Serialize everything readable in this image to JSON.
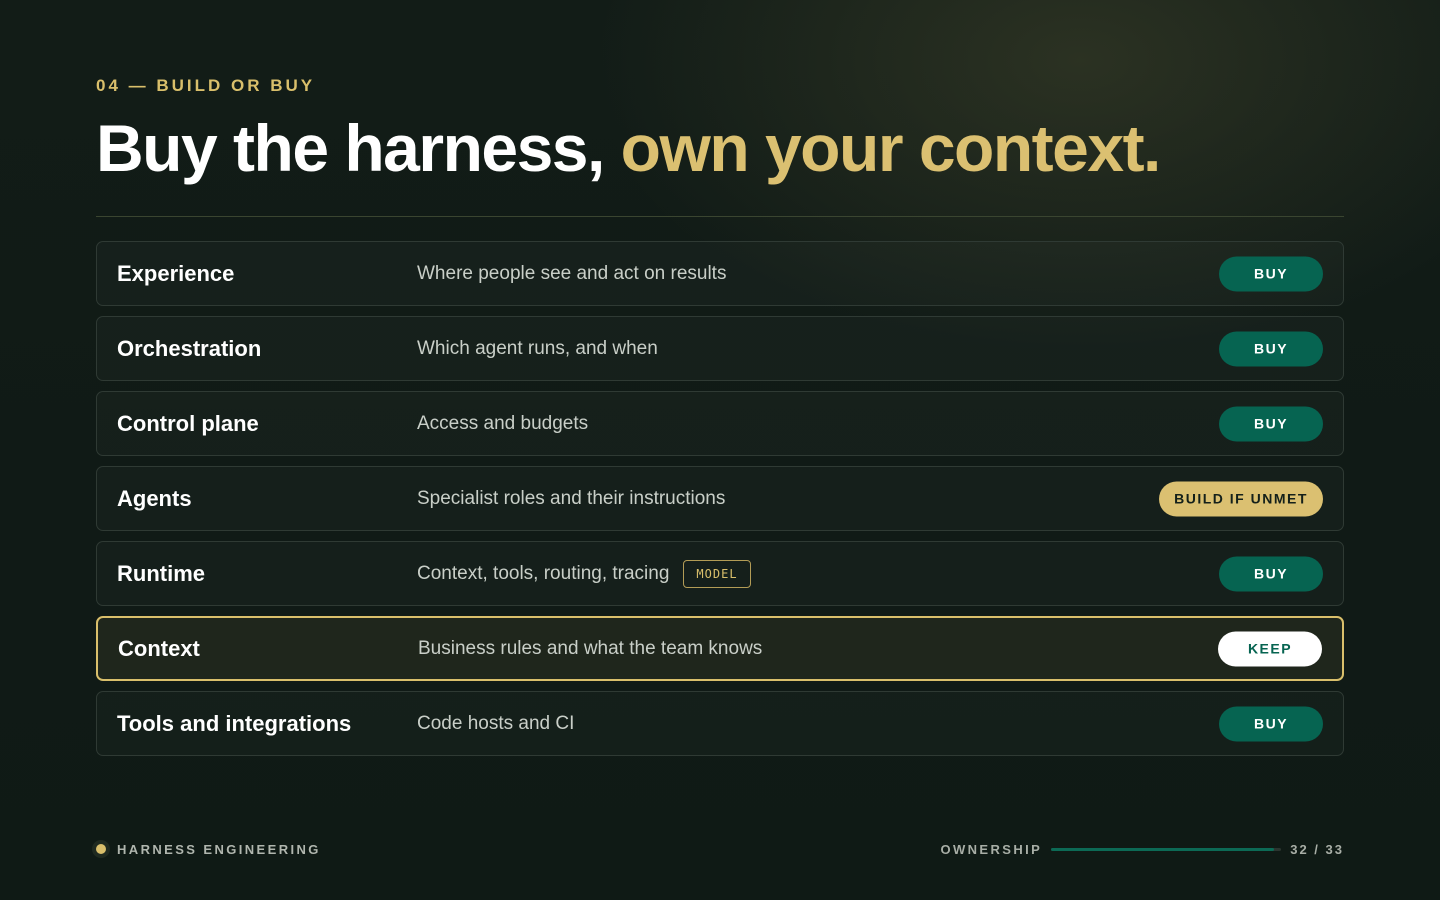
{
  "header": {
    "eyebrow": "04 — BUILD OR BUY",
    "headline_part1": "Buy the harness, ",
    "headline_part2": "own your context."
  },
  "rows": [
    {
      "name": "Experience",
      "description": "Where people see and act on results",
      "decision": "BUY"
    },
    {
      "name": "Orchestration",
      "description": "Which agent runs, and when",
      "decision": "BUY"
    },
    {
      "name": "Control plane",
      "description": "Access and budgets",
      "decision": "BUY"
    },
    {
      "name": "Agents",
      "description": "Specialist roles and their instructions",
      "decision": "BUILD IF UNMET"
    },
    {
      "name": "Runtime",
      "description": "Context, tools, routing, tracing",
      "tag": "MODEL",
      "decision": "BUY"
    },
    {
      "name": "Context",
      "description": "Business rules and what the team knows",
      "decision": "KEEP"
    },
    {
      "name": "Tools and integrations",
      "description": "Code hosts and CI",
      "decision": "BUY"
    }
  ],
  "footer": {
    "brand": "HARNESS ENGINEERING",
    "section": "OWNERSHIP",
    "progress_fraction": 0.97,
    "page": "32 / 33"
  },
  "colors": {
    "accent_gold": "#d9bf6b",
    "buy_green": "#066451",
    "background": "#111b16"
  }
}
